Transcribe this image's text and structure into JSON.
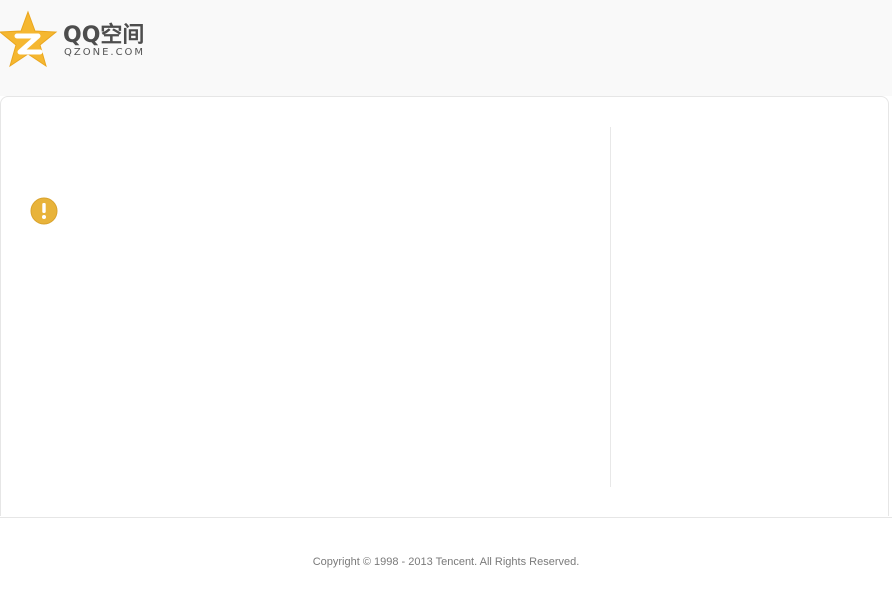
{
  "header": {
    "logo": {
      "title": "QQ空间",
      "subtitle": "QZONE.COM",
      "icon": "qzone-star-icon",
      "star_color": "#f5b731",
      "letter_color": "#ffffff"
    }
  },
  "main": {
    "status_icon": "warning-icon",
    "status_icon_color": "#e8b33a",
    "message": ""
  },
  "footer": {
    "copyright": "Copyright © 1998 - 2013 Tencent. All Rights Reserved."
  }
}
